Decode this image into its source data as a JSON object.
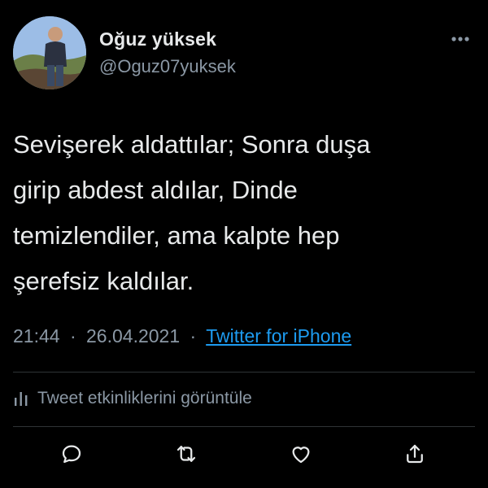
{
  "tweet": {
    "author": {
      "display_name": "Oğuz yüksek",
      "handle": "@Oguz07yuksek",
      "avatar_icon": "profile-photo"
    },
    "more_icon": "more-dots-icon",
    "text": "Sevişerek aldattılar; Sonra duşa\ngirip abdest aldılar, Dinde\ntemizlendiler, ama kalpte hep\nşerefsiz kaldılar.",
    "time": "21:44",
    "separator": "·",
    "date": "26.04.2021",
    "source": "Twitter for iPhone",
    "activity_label": "Tweet etkinliklerini görüntüle",
    "actions": [
      "reply-icon",
      "retweet-icon",
      "like-icon",
      "share-icon"
    ]
  },
  "colors": {
    "background": "#000000",
    "text": "#e7e9ea",
    "secondary": "#8b98a5",
    "link": "#1d9bf0",
    "divider": "#2f3336"
  }
}
